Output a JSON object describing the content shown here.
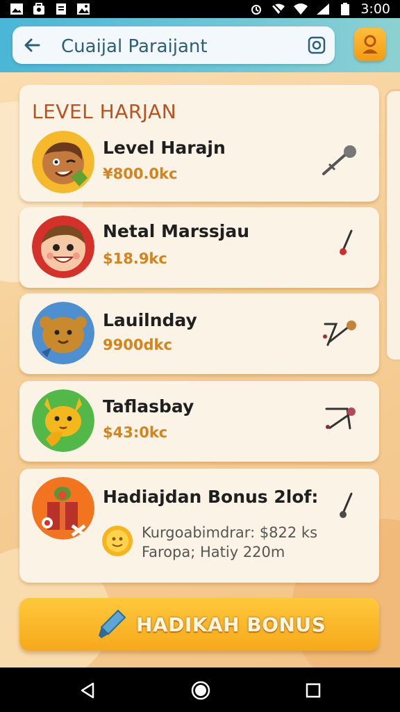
{
  "status_bar": {
    "time": "3:00",
    "left_icons": [
      "image-icon",
      "bag-icon",
      "doc-icon",
      "photo-icon"
    ],
    "right_icons": [
      "alarm-icon",
      "wifi-off-icon",
      "wifi-icon",
      "signal-icon",
      "battery-icon"
    ]
  },
  "header": {
    "search_text": "Cuaijal Paraijant",
    "back_icon": "arrow-left-icon",
    "scan_icon": "scan-icon",
    "profile_icon": "user-icon"
  },
  "section": {
    "title": "LEVEL HARJAN"
  },
  "items": [
    {
      "name": "Level Harajn",
      "price": "¥800.0kc",
      "avatar": "winking-face-avatar",
      "tool": "key-tool-icon"
    },
    {
      "name": "Netal Marssjau",
      "price": "$18.9kc",
      "avatar": "smiling-boy-avatar",
      "tool": "pin-tool-icon"
    },
    {
      "name": "Lauilnday",
      "price": "9900dkc",
      "avatar": "bear-avatar",
      "tool": "link-tool-icon"
    },
    {
      "name": "Taflasbay",
      "price": "$43:0kc",
      "avatar": "fox-avatar",
      "tool": "cart-tool-icon"
    }
  ],
  "bonus_card": {
    "title": "Hadiajdan Bonus 2lof:",
    "line1": "Kurgoabimdrar: $822 ks",
    "line2": "Faropa; Hatiy 220m",
    "avatar": "gift-box-avatar",
    "tool": "pin-tool-icon"
  },
  "bonus_button": {
    "label": "HADIKAH BONUS",
    "icon": "paintbrush-icon"
  },
  "colors": {
    "accent": "#f7a81b",
    "header": "#4bb6d6",
    "price": "#d4831d",
    "title": "#b8521e"
  },
  "nav": {
    "back": "nav-back-icon",
    "home": "nav-home-icon",
    "recents": "nav-recents-icon"
  }
}
